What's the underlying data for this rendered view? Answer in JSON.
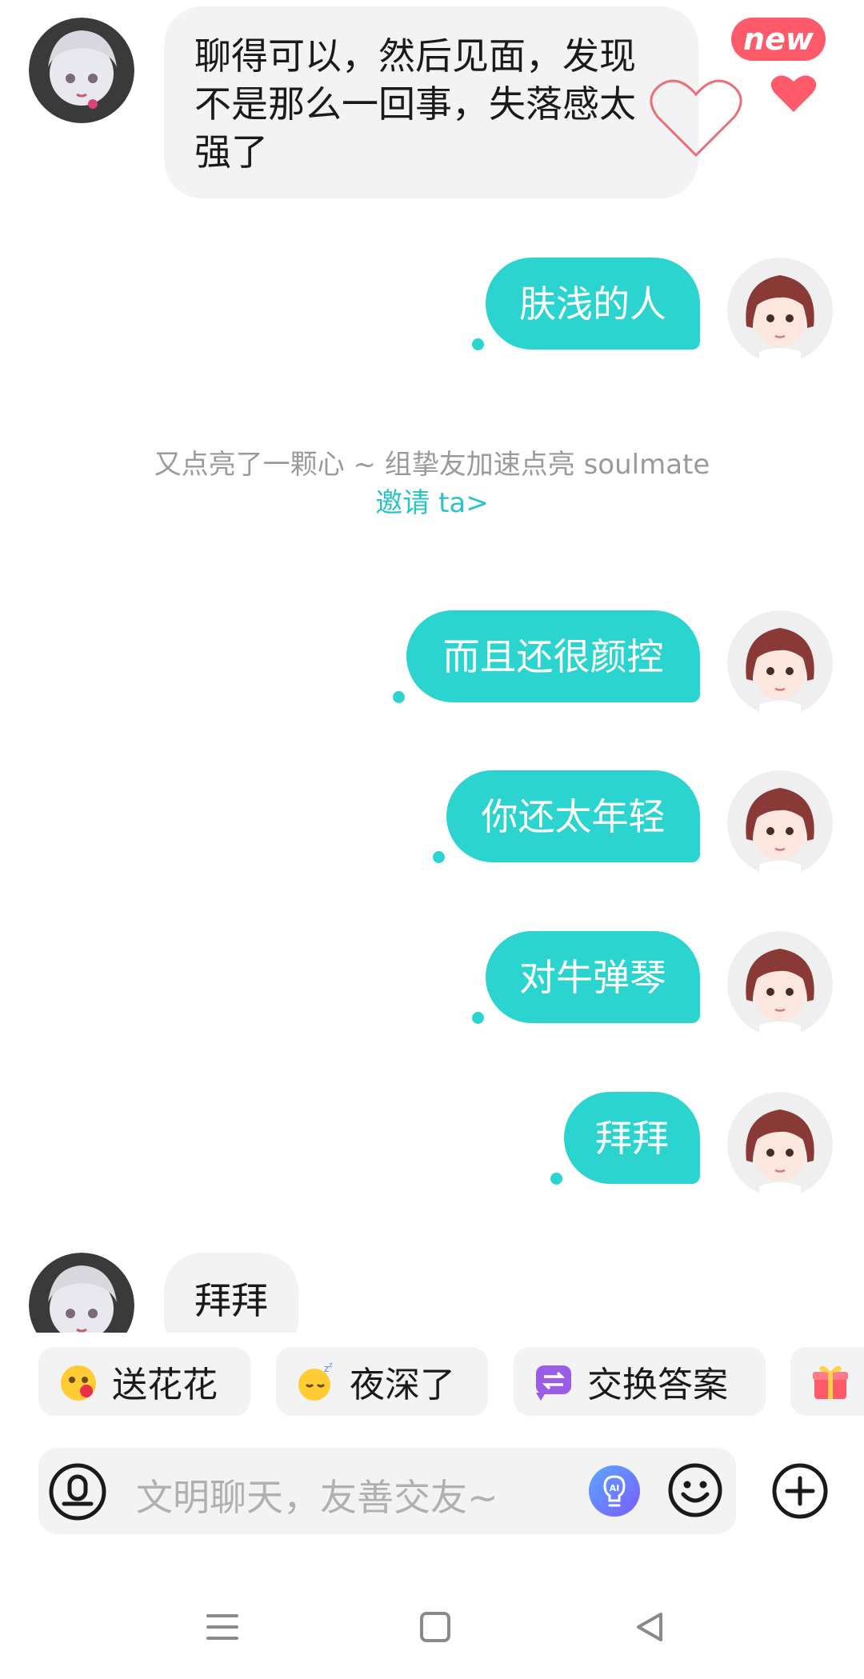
{
  "badge": {
    "new_label": "new"
  },
  "messages": [
    {
      "side": "in",
      "text": "聊得可以，然后见面，发现\n不是那么一回事，失落感太\n强了"
    },
    {
      "side": "out",
      "text": "肤浅的人"
    },
    {
      "side": "out",
      "text": "而且还很颜控"
    },
    {
      "side": "out",
      "text": "你还太年轻"
    },
    {
      "side": "out",
      "text": "对牛弹琴"
    },
    {
      "side": "out",
      "text": "拜拜"
    },
    {
      "side": "in",
      "text": "拜拜"
    }
  ],
  "system_note": {
    "text": "又点亮了一颗心 ~ 组挚友加速点亮 soulmate",
    "link": "邀请 ta>"
  },
  "quick_actions": [
    {
      "label": "送花花",
      "icon": "flower-face-icon"
    },
    {
      "label": "夜深了",
      "icon": "sleepy-face-icon"
    },
    {
      "label": "交换答案",
      "icon": "exchange-icon"
    },
    {
      "label": "",
      "icon": "gift-icon"
    }
  ],
  "input": {
    "placeholder": "文明聊天，友善交友~"
  },
  "colors": {
    "accent": "#2bd4cf",
    "badge": "#ff5a6a",
    "heart": "#ff5a6a",
    "incoming_bubble": "#f3f3f3"
  }
}
